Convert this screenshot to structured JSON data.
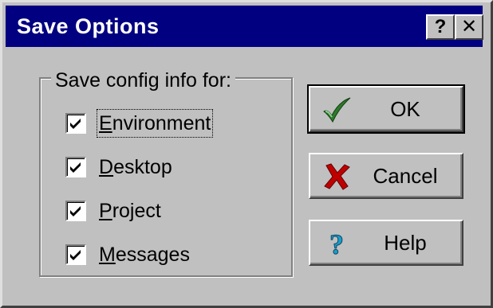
{
  "window": {
    "title": "Save Options",
    "help_glyph": "?",
    "close_glyph": "✕"
  },
  "group": {
    "legend": "Save config info for:",
    "items": [
      {
        "key": "E",
        "rest": "nvironment",
        "checked": true,
        "focused": true
      },
      {
        "key": "D",
        "rest": "esktop",
        "checked": true,
        "focused": false
      },
      {
        "key": "P",
        "rest": "roject",
        "checked": true,
        "focused": false
      },
      {
        "key": "M",
        "rest": "essages",
        "checked": true,
        "focused": false
      }
    ]
  },
  "buttons": {
    "ok": {
      "label": "OK",
      "icon": "checkmark-icon",
      "color": "#2d7a2d"
    },
    "cancel": {
      "label": "Cancel",
      "icon": "red-x-icon",
      "color": "#c00000"
    },
    "help": {
      "label": "Help",
      "icon": "question-mark-icon",
      "color": "#1e9bc8"
    }
  },
  "colors": {
    "titlebar": "#000080",
    "face": "#c0c0c0"
  }
}
